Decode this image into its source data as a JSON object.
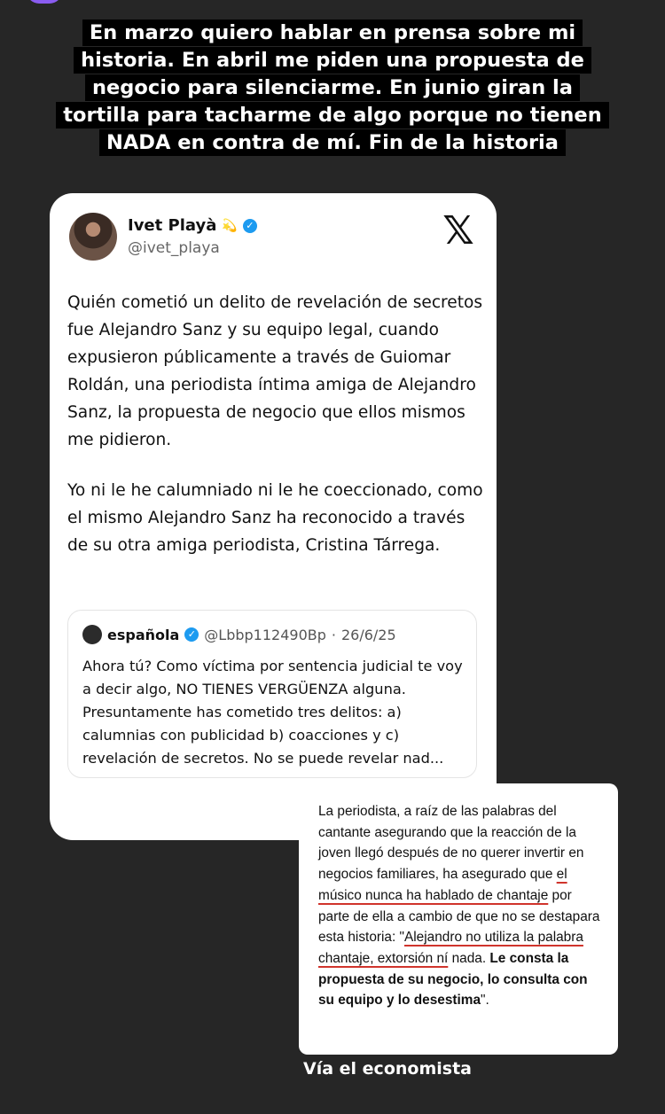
{
  "story": {
    "headline": "En marzo quiero hablar en prensa sobre mi historia. En abril me piden una propuesta de negocio para silenciarme. En junio giran la tortilla para tacharme de algo porque no tienen NADA en contra de mí. Fin de la historia",
    "source_caption": "Vía el economista"
  },
  "tweet": {
    "author_name": "Ivet Playà",
    "author_emoji": "💫",
    "handle": "@ivet_playa",
    "logo": "x-logo-icon",
    "paragraphs": [
      "Quién cometió un delito de revelación de secretos fue Alejandro Sanz y su equipo legal, cuando expusieron públicamente a través de Guiomar Roldán, una periodista íntima amiga de Alejandro Sanz, la propuesta de negocio que ellos mismos me pidieron.",
      "Yo ni le he calumniado ni le he coeccionado, como el mismo Alejandro Sanz ha reconocido a través de su otra amiga periodista, Cristina Tárrega."
    ],
    "quoted": {
      "author_name": "española",
      "handle": "@Lbbp112490Bp",
      "date": "26/6/25",
      "separator": "·",
      "text": "Ahora tú? Como víctima por sentencia judicial te voy a decir algo, NO TIENES VERGÜENZA alguna. Presuntamente has cometido tres delitos: a) calumnias con publicidad b) coacciones y c) revelación de secretos. No se puede revelar nad..."
    }
  },
  "article": {
    "intro": "La periodista, a raíz de las palabras del cantante asegurando que la reacción de la joven llegó después de no querer invertir en negocios familiares, ha asegurado que ",
    "underline_1": "el músico nunca ha hablado de chantaje",
    "middle": " por parte de ella a cambio de que no se destapara esta historia: \"",
    "underline_2": "Alejandro no utiliza la palabra chantaje, extorsión ní",
    "tail": " nada. ",
    "bold": "Le consta la propuesta de su negocio, lo consulta con su equipo y lo desestima",
    "end": "\"."
  },
  "colors": {
    "background": "#262626",
    "verified": "#1d9bf0",
    "underline": "#d0342c"
  }
}
